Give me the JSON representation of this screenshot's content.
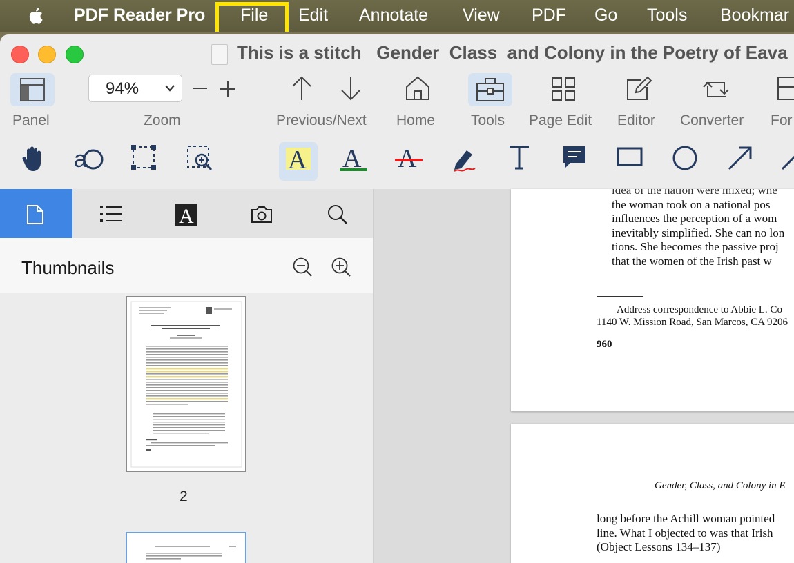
{
  "menubar": {
    "app_name": "PDF Reader Pro",
    "items": [
      "File",
      "Edit",
      "Annotate",
      "View",
      "PDF",
      "Go",
      "Tools",
      "Bookmar"
    ],
    "highlighted_item": "File",
    "highlight_color": "#ffe400"
  },
  "window": {
    "title": "This is a stitch   Gender  Class  and Colony in the Poetry of Eava"
  },
  "toolbar": {
    "panel_label": "Panel",
    "zoom_value": "94%",
    "zoom_label": "Zoom",
    "prevnext_label": "Previous/Next",
    "home_label": "Home",
    "tools_label": "Tools",
    "page_edit_label": "Page Edit",
    "editor_label": "Editor",
    "converter_label": "Converter",
    "form_label": "For",
    "selected_color": "#d5e2f2"
  },
  "annotation_tools": [
    "hand-tool",
    "text-select-tool",
    "area-select-tool",
    "zoom-select-tool",
    "highlight-tool",
    "underline-tool",
    "strikethrough-tool",
    "freehand-tool",
    "text-tool",
    "note-tool",
    "rectangle-tool",
    "circle-tool",
    "arrow-tool",
    "line-tool"
  ],
  "sidebar": {
    "tabs": [
      "thumbnails-tab",
      "outline-tab",
      "annotations-tab",
      "snapshot-tab",
      "search-tab"
    ],
    "active_tab_color": "#3f86e4",
    "heading": "Thumbnails",
    "page_2_label": "2"
  },
  "document": {
    "page_a_lines": [
      "idea of the nation were mixed; whe",
      "the woman took on a national pos",
      "influences the perception of a wom",
      "inevitably simplified. She can no lon",
      "tions. She becomes the passive proj",
      "that the women of the Irish past w"
    ],
    "footnote_1": "Address correspondence to Abbie L. Co",
    "footnote_2": "1140 W. Mission Road, San Marcos, CA 9206",
    "page_number": "960",
    "page_b_header": "Gender, Class, and Colony in E",
    "page_b_lines": [
      "long before the Achill woman pointed",
      "line. What I objected to was that Irish",
      "(Object Lessons 134–137)"
    ]
  }
}
